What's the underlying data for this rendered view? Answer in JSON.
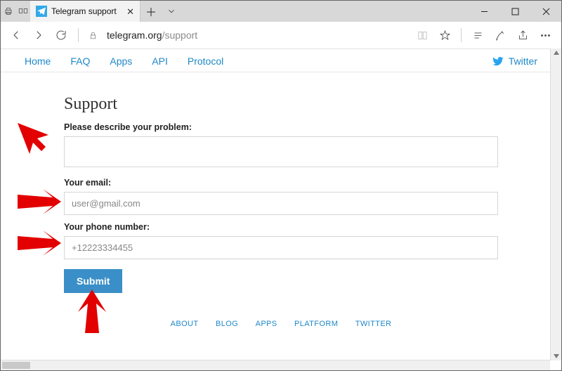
{
  "window": {
    "tab_title": "Telegram support",
    "url_host": "telegram.org",
    "url_path": "/support"
  },
  "nav": {
    "home": "Home",
    "faq": "FAQ",
    "apps": "Apps",
    "api": "API",
    "protocol": "Protocol",
    "twitter": "Twitter"
  },
  "page": {
    "heading": "Support",
    "problem_label": "Please describe your problem:",
    "problem_value": "",
    "email_label": "Your email:",
    "email_placeholder": "user@gmail.com",
    "phone_label": "Your phone number:",
    "phone_placeholder": "+12223334455",
    "submit": "Submit"
  },
  "footer": {
    "about": "ABOUT",
    "blog": "BLOG",
    "apps": "APPS",
    "platform": "PLATFORM",
    "twitter": "TWITTER"
  }
}
